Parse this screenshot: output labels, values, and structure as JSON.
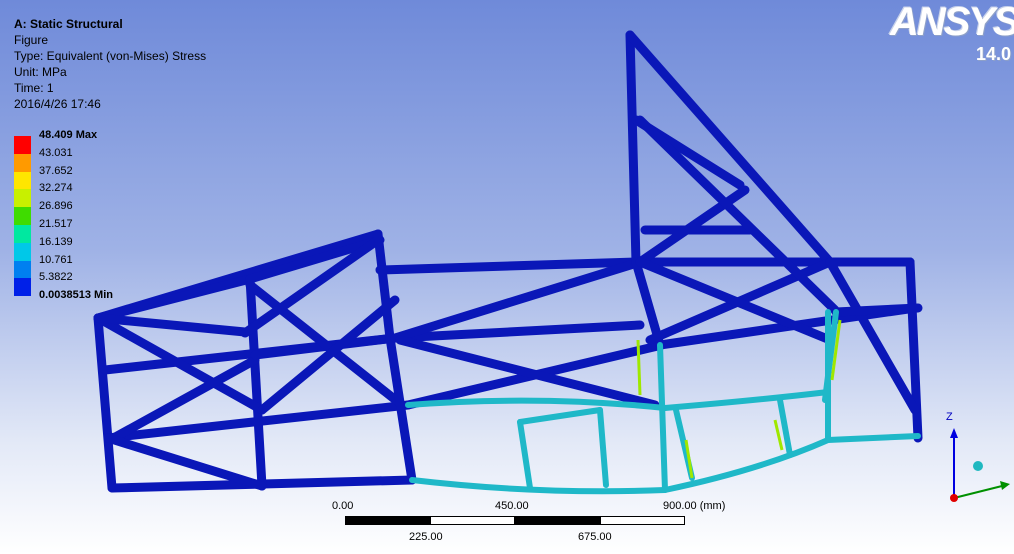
{
  "info": {
    "title": "A: Static Structural",
    "line1": "Figure",
    "line2": "Type: Equivalent (von-Mises) Stress",
    "line3": "Unit: MPa",
    "line4": "Time: 1",
    "line5": "2016/4/26 17:46"
  },
  "legend": {
    "max_label": "48.409 Max",
    "values": [
      "43.031",
      "37.652",
      "32.274",
      "26.896",
      "21.517",
      "16.139",
      "10.761",
      "5.3822"
    ],
    "min_label": "0.0038513 Min",
    "colors": [
      "#ff0000",
      "#ff9a00",
      "#ffe600",
      "#c8f000",
      "#3fdc00",
      "#00e8a0",
      "#00c8e8",
      "#0080f0",
      "#0020e8"
    ]
  },
  "logo": {
    "text": "ANSYS",
    "version": "14.0"
  },
  "scalebar": {
    "top_labels": [
      "0.00",
      "450.00",
      "900.00 (mm)"
    ],
    "bottom_labels": [
      "225.00",
      "675.00"
    ]
  },
  "triad": {
    "z_label": "Z"
  }
}
